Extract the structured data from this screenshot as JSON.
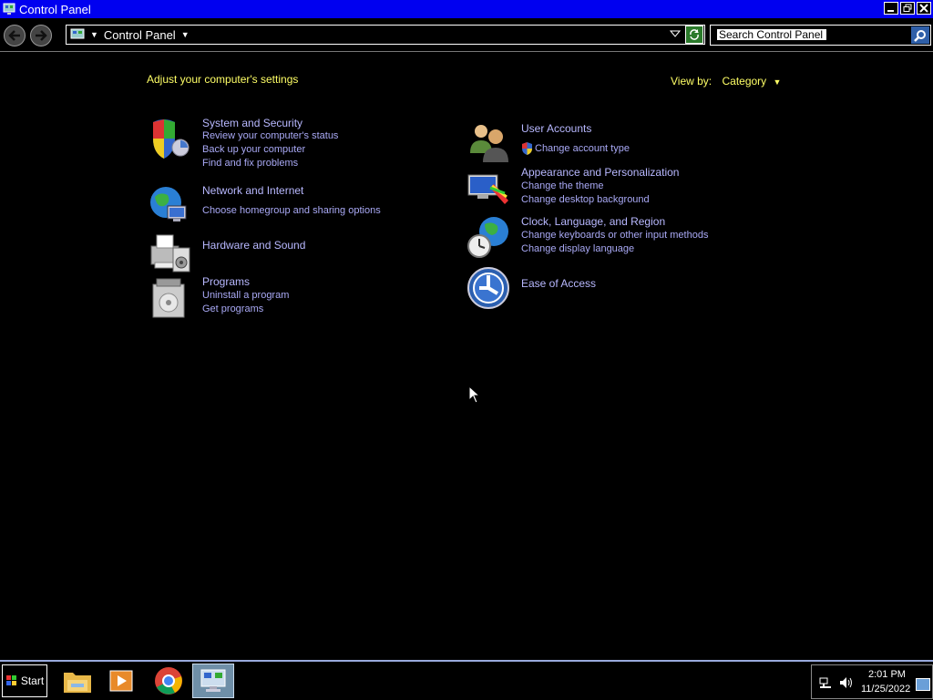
{
  "window": {
    "title": "Control Panel"
  },
  "address": {
    "breadcrumb": "Control Panel",
    "search_placeholder": "Search Control Panel"
  },
  "main": {
    "heading": "Adjust your computer's settings",
    "view_by_label": "View by:",
    "view_by_value": "Category",
    "left_categories": [
      {
        "title": "System and Security",
        "links": [
          "Review your computer's status",
          "Back up your computer",
          "Find and fix problems"
        ]
      },
      {
        "title": "Network and Internet",
        "links": [
          "Choose homegroup and sharing options"
        ]
      },
      {
        "title": "Hardware and Sound",
        "links": []
      },
      {
        "title": "Programs",
        "links": [
          "Uninstall a program",
          "Get programs"
        ]
      }
    ],
    "right_categories": [
      {
        "title": "User Accounts",
        "links": [
          "Change account type"
        ]
      },
      {
        "title": "Appearance and Personalization",
        "links": [
          "Change the theme",
          "Change desktop background"
        ]
      },
      {
        "title": "Clock, Language, and Region",
        "links": [
          "Change keyboards or other input methods",
          "Change display language"
        ]
      },
      {
        "title": "Ease of Access",
        "links": []
      }
    ]
  },
  "taskbar": {
    "start_label": "Start",
    "items": [
      "file-explorer-icon",
      "media-player-icon",
      "chrome-icon",
      "control-panel-icon"
    ],
    "clock_time": "2:01 PM",
    "clock_date": "11/25/2022"
  },
  "colors": {
    "titlebar": "#0000f0",
    "heading": "#ffff66",
    "link": "#a9a9f5",
    "background": "#000000"
  }
}
